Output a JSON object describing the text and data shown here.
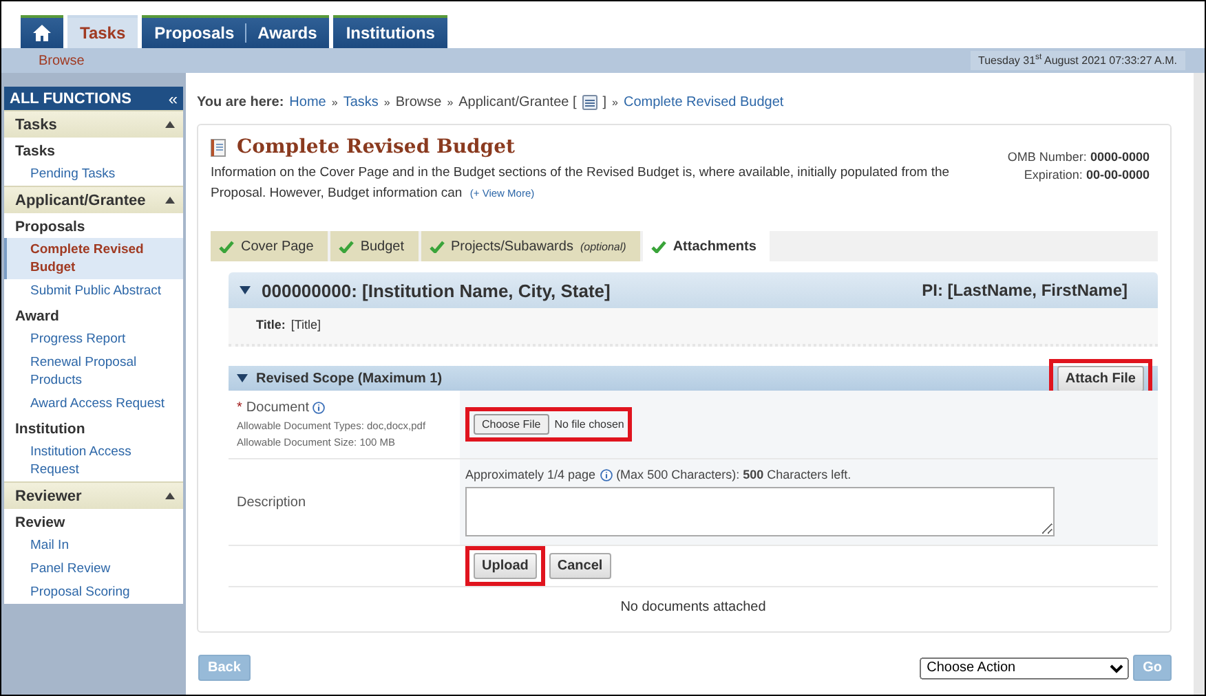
{
  "nav": {
    "tabs": [
      {
        "kind": "home",
        "selected": false
      },
      {
        "kind": "text",
        "selected": true,
        "labels": [
          "Tasks"
        ]
      },
      {
        "kind": "text",
        "selected": false,
        "labels": [
          "Proposals",
          "Awards"
        ]
      },
      {
        "kind": "text",
        "selected": false,
        "labels": [
          "Institutions"
        ]
      }
    ]
  },
  "subnav": {
    "label": "Browse",
    "datetime": "Tuesday 31$^{st}$ August 2021 07:33:27 A.M."
  },
  "sidebar": {
    "title": "ALL FUNCTIONS",
    "collapse": "«",
    "sections": [
      {
        "title": "Tasks",
        "expanded": true,
        "groups": [
          {
            "title": "Tasks",
            "items": [
              {
                "label": "Pending Tasks",
                "selected": false
              }
            ]
          }
        ]
      },
      {
        "title": "Applicant/Grantee",
        "expanded": true,
        "groups": [
          {
            "title": "Proposals",
            "items": [
              {
                "label": "Complete Revised Budget",
                "selected": true
              },
              {
                "label": "Submit Public Abstract",
                "selected": false
              }
            ]
          },
          {
            "title": "Award",
            "items": [
              {
                "label": "Progress Report",
                "selected": false
              },
              {
                "label": "Renewal Proposal Products",
                "selected": false
              },
              {
                "label": "Award Access Request",
                "selected": false
              }
            ]
          },
          {
            "title": "Institution",
            "items": [
              {
                "label": "Institution Access Request",
                "selected": false
              }
            ]
          }
        ]
      },
      {
        "title": "Reviewer",
        "expanded": true,
        "groups": [
          {
            "title": "Review",
            "items": [
              {
                "label": "Mail In",
                "selected": false
              },
              {
                "label": "Panel Review",
                "selected": false
              },
              {
                "label": "Proposal Scoring",
                "selected": false
              }
            ]
          }
        ]
      }
    ]
  },
  "breadcrumb": {
    "prefix": "You are here:",
    "items": [
      {
        "kind": "link",
        "label": "Home"
      },
      {
        "kind": "sep",
        "label": "»"
      },
      {
        "kind": "link",
        "label": "Tasks"
      },
      {
        "kind": "sep",
        "label": "»"
      },
      {
        "kind": "text",
        "label": "Browse"
      },
      {
        "kind": "sep",
        "label": "»"
      },
      {
        "kind": "text",
        "label": "Applicant/Grantee ["
      },
      {
        "kind": "icon"
      },
      {
        "kind": "text",
        "label": "]"
      },
      {
        "kind": "sep",
        "label": "»"
      },
      {
        "kind": "link",
        "label": "Complete Revised Budget"
      }
    ]
  },
  "page": {
    "title": "Complete Revised Budget",
    "intro": "Information on the Cover Page and in the Budget sections of the Revised Budget is, where available, initially populated from the Proposal. However, Budget information can",
    "view_more": "(+ View More)",
    "omb": [
      {
        "label": "OMB Number:",
        "value": "0000-0000"
      },
      {
        "label": "Expiration:",
        "value": "00-00-0000"
      }
    ]
  },
  "steps": [
    {
      "label": "Cover Page",
      "complete": true,
      "selected": false
    },
    {
      "label": "Budget",
      "complete": true,
      "selected": false
    },
    {
      "label": "Projects/Subawards",
      "note": "(optional)",
      "complete": true,
      "selected": false
    },
    {
      "label": "Attachments",
      "complete": true,
      "selected": true
    }
  ],
  "record": {
    "expanded": true,
    "heading": "000000000: [Institution Name, City, State]",
    "pi": "PI: [LastName, FirstName]",
    "title_label": "Title:",
    "title_value": "[Title]"
  },
  "scope": {
    "title": "Revised Scope (Maximum 1)",
    "expanded": true,
    "attach": {
      "label": "Attach File",
      "highlighted": true
    }
  },
  "document": {
    "required": true,
    "required_mark": "*",
    "label": "Document",
    "types": "Allowable Document Types: doc,docx,pdf",
    "size": "Allowable Document Size: 100 MB",
    "file_input": {
      "button": "Choose File",
      "status": "No file chosen",
      "highlighted": true
    }
  },
  "description": {
    "label": "Description",
    "hint": "Approximately 1/4 page",
    "limit": "(Max 500 Characters): **500** Characters left."
  },
  "actions": [
    {
      "label": "Upload",
      "highlighted": true
    },
    {
      "label": "Cancel",
      "highlighted": false
    }
  ],
  "empty": "No documents attached",
  "footer": {
    "back": "Back",
    "action_select": "Choose Action",
    "go": "Go"
  }
}
